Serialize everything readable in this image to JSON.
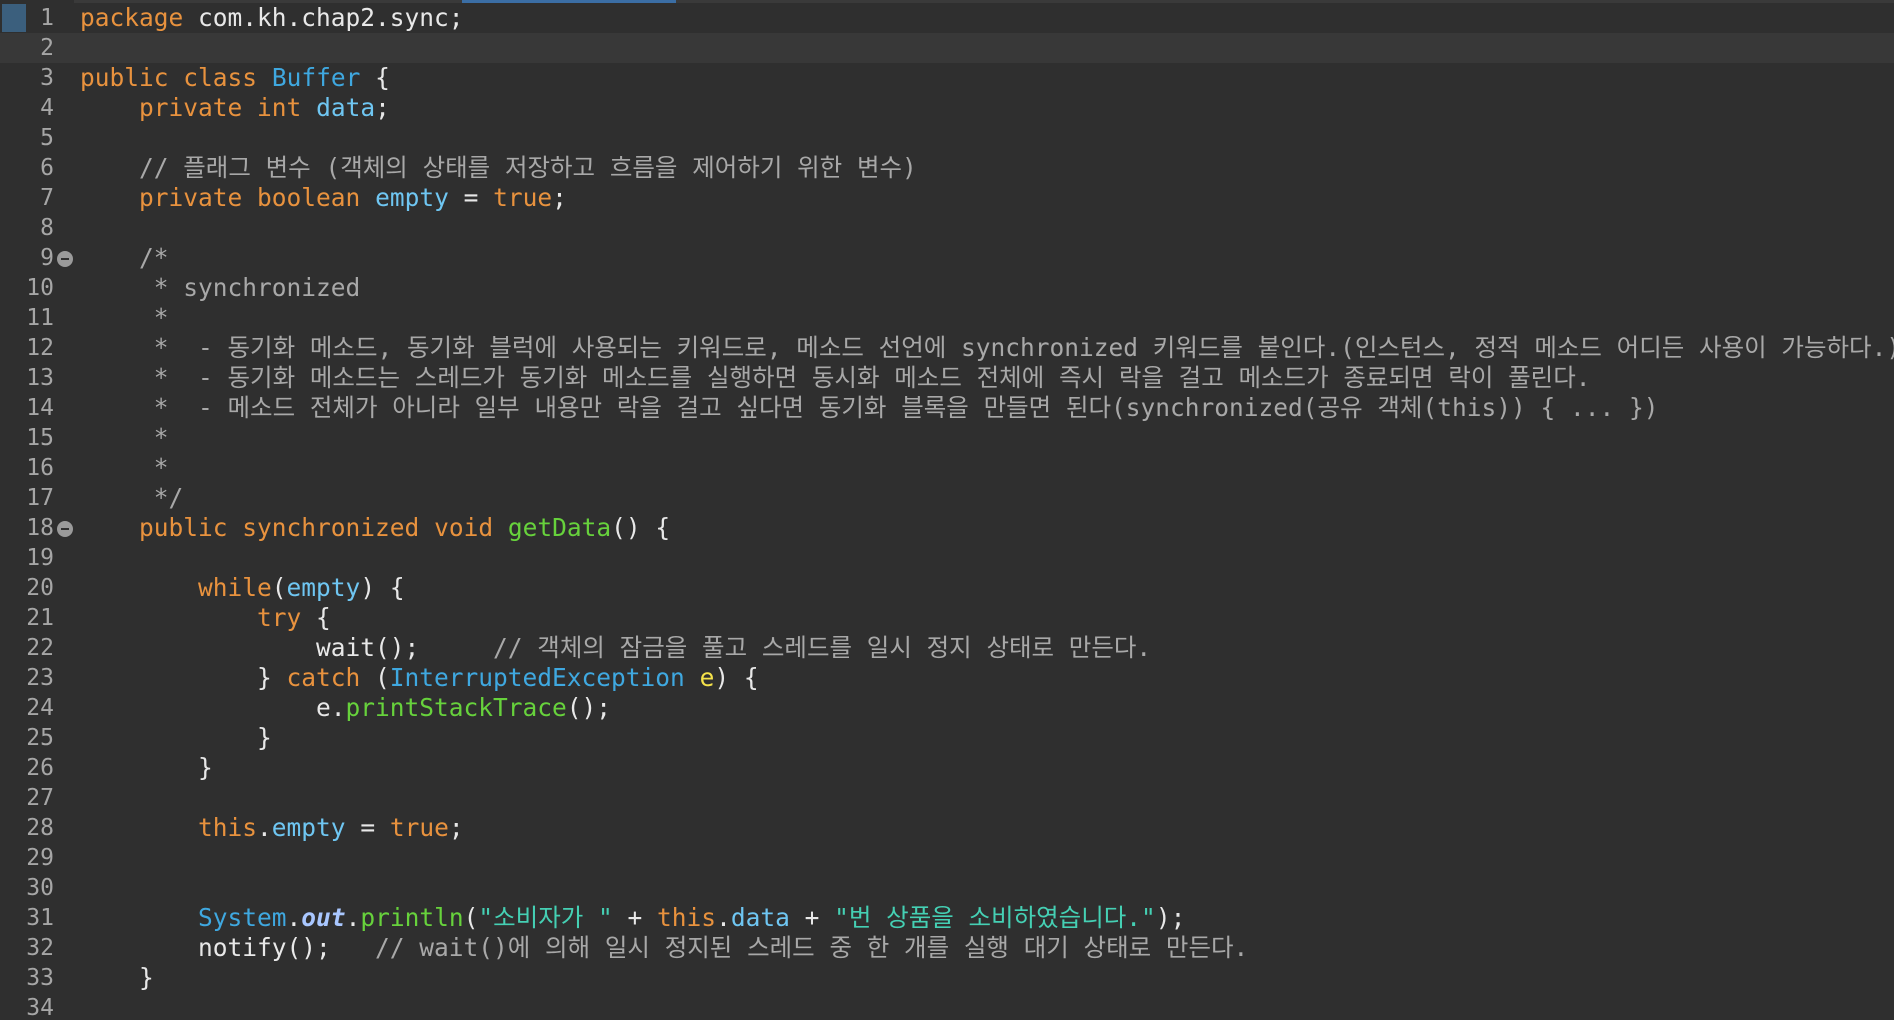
{
  "editor": {
    "lines": [
      {
        "n": "1",
        "tokens": [
          {
            "t": "package",
            "c": "kw"
          },
          {
            "t": " com.kh.chap2.sync;",
            "c": "pl"
          }
        ]
      },
      {
        "n": "2",
        "tokens": []
      },
      {
        "n": "3",
        "tokens": [
          {
            "t": "public",
            "c": "kw"
          },
          {
            "t": " ",
            "c": "pl"
          },
          {
            "t": "class",
            "c": "kw"
          },
          {
            "t": " ",
            "c": "pl"
          },
          {
            "t": "Buffer",
            "c": "ty"
          },
          {
            "t": " {",
            "c": "pl"
          }
        ]
      },
      {
        "n": "4",
        "tokens": [
          {
            "t": "    ",
            "c": "pl"
          },
          {
            "t": "private",
            "c": "kw"
          },
          {
            "t": " ",
            "c": "pl"
          },
          {
            "t": "int",
            "c": "kw"
          },
          {
            "t": " ",
            "c": "pl"
          },
          {
            "t": "data",
            "c": "fld"
          },
          {
            "t": ";",
            "c": "pl"
          }
        ]
      },
      {
        "n": "5",
        "tokens": []
      },
      {
        "n": "6",
        "tokens": [
          {
            "t": "    // 플래그 변수 (객체의 상태를 저장하고 흐름을 제어하기 위한 변수)",
            "c": "cm"
          }
        ]
      },
      {
        "n": "7",
        "tokens": [
          {
            "t": "    ",
            "c": "pl"
          },
          {
            "t": "private",
            "c": "kw"
          },
          {
            "t": " ",
            "c": "pl"
          },
          {
            "t": "boolean",
            "c": "kw"
          },
          {
            "t": " ",
            "c": "pl"
          },
          {
            "t": "empty",
            "c": "fld"
          },
          {
            "t": " = ",
            "c": "pl"
          },
          {
            "t": "true",
            "c": "kw"
          },
          {
            "t": ";",
            "c": "pl"
          }
        ]
      },
      {
        "n": "8",
        "tokens": []
      },
      {
        "n": "9",
        "fold": true,
        "tokens": [
          {
            "t": "    /*",
            "c": "cm"
          }
        ]
      },
      {
        "n": "10",
        "tokens": [
          {
            "t": "     * synchronized",
            "c": "cm"
          }
        ]
      },
      {
        "n": "11",
        "tokens": [
          {
            "t": "     *",
            "c": "cm"
          }
        ]
      },
      {
        "n": "12",
        "tokens": [
          {
            "t": "     *  - 동기화 메소드, 동기화 블럭에 사용되는 키워드로, 메소드 선언에 synchronized 키워드를 붙인다.(인스턴스, 정적 메소드 어디든 사용이 가능하다.)",
            "c": "cm"
          }
        ]
      },
      {
        "n": "13",
        "tokens": [
          {
            "t": "     *  - 동기화 메소드는 스레드가 동기화 메소드를 실행하면 동시화 메소드 전체에 즉시 락을 걸고 메소드가 종료되면 락이 풀린다.",
            "c": "cm"
          }
        ]
      },
      {
        "n": "14",
        "tokens": [
          {
            "t": "     *  - 메소드 전체가 아니라 일부 내용만 락을 걸고 싶다면 동기화 블록을 만들면 된다(synchronized(공유 객체(this)) { ... })",
            "c": "cm"
          }
        ]
      },
      {
        "n": "15",
        "tokens": [
          {
            "t": "     *",
            "c": "cm"
          }
        ]
      },
      {
        "n": "16",
        "tokens": [
          {
            "t": "     *",
            "c": "cm"
          }
        ]
      },
      {
        "n": "17",
        "tokens": [
          {
            "t": "     */",
            "c": "cm"
          }
        ]
      },
      {
        "n": "18",
        "fold": true,
        "tokens": [
          {
            "t": "    ",
            "c": "pl"
          },
          {
            "t": "public",
            "c": "kw"
          },
          {
            "t": " ",
            "c": "pl"
          },
          {
            "t": "synchronized",
            "c": "kw"
          },
          {
            "t": " ",
            "c": "pl"
          },
          {
            "t": "void",
            "c": "kw"
          },
          {
            "t": " ",
            "c": "pl"
          },
          {
            "t": "getData",
            "c": "mth"
          },
          {
            "t": "() {",
            "c": "pl"
          }
        ]
      },
      {
        "n": "19",
        "tokens": []
      },
      {
        "n": "20",
        "tokens": [
          {
            "t": "        ",
            "c": "pl"
          },
          {
            "t": "while",
            "c": "kw"
          },
          {
            "t": "(",
            "c": "pl"
          },
          {
            "t": "empty",
            "c": "fld"
          },
          {
            "t": ") {",
            "c": "pl"
          }
        ]
      },
      {
        "n": "21",
        "tokens": [
          {
            "t": "            ",
            "c": "pl"
          },
          {
            "t": "try",
            "c": "kw"
          },
          {
            "t": " {",
            "c": "pl"
          }
        ]
      },
      {
        "n": "22",
        "tokens": [
          {
            "t": "                ",
            "c": "pl"
          },
          {
            "t": "wait",
            "c": "pl"
          },
          {
            "t": "();     ",
            "c": "pl"
          },
          {
            "t": "// 객체의 잠금을 풀고 스레드를 일시 정지 상태로 만든다.",
            "c": "cm"
          }
        ]
      },
      {
        "n": "23",
        "tokens": [
          {
            "t": "            } ",
            "c": "pl"
          },
          {
            "t": "catch",
            "c": "kw"
          },
          {
            "t": " (",
            "c": "pl"
          },
          {
            "t": "InterruptedException",
            "c": "ty"
          },
          {
            "t": " ",
            "c": "pl"
          },
          {
            "t": "e",
            "c": "loc"
          },
          {
            "t": ") {",
            "c": "pl"
          }
        ]
      },
      {
        "n": "24",
        "tokens": [
          {
            "t": "                e.",
            "c": "pl"
          },
          {
            "t": "printStackTrace",
            "c": "mth"
          },
          {
            "t": "();",
            "c": "pl"
          }
        ]
      },
      {
        "n": "25",
        "tokens": [
          {
            "t": "            }",
            "c": "pl"
          }
        ]
      },
      {
        "n": "26",
        "tokens": [
          {
            "t": "        }",
            "c": "pl"
          }
        ]
      },
      {
        "n": "27",
        "tokens": []
      },
      {
        "n": "28",
        "tokens": [
          {
            "t": "        ",
            "c": "pl"
          },
          {
            "t": "this",
            "c": "kw"
          },
          {
            "t": ".",
            "c": "pl"
          },
          {
            "t": "empty",
            "c": "fld"
          },
          {
            "t": " = ",
            "c": "pl"
          },
          {
            "t": "true",
            "c": "kw"
          },
          {
            "t": ";",
            "c": "pl"
          }
        ]
      },
      {
        "n": "29",
        "tokens": []
      },
      {
        "n": "30",
        "tokens": []
      },
      {
        "n": "31",
        "tokens": [
          {
            "t": "        ",
            "c": "pl"
          },
          {
            "t": "System",
            "c": "ty"
          },
          {
            "t": ".",
            "c": "pl"
          },
          {
            "t": "out",
            "c": "sfld"
          },
          {
            "t": ".",
            "c": "pl"
          },
          {
            "t": "println",
            "c": "mth"
          },
          {
            "t": "(",
            "c": "pl"
          },
          {
            "t": "\"소비자가 \"",
            "c": "str"
          },
          {
            "t": " + ",
            "c": "pl"
          },
          {
            "t": "this",
            "c": "kw"
          },
          {
            "t": ".",
            "c": "pl"
          },
          {
            "t": "data",
            "c": "fld"
          },
          {
            "t": " + ",
            "c": "pl"
          },
          {
            "t": "\"번 상품을 소비하였습니다.\"",
            "c": "str"
          },
          {
            "t": ");",
            "c": "pl"
          }
        ]
      },
      {
        "n": "32",
        "tokens": [
          {
            "t": "        notify();   ",
            "c": "pl"
          },
          {
            "t": "// wait()에 의해 일시 정지된 스레드 중 한 개를 실행 대기 상태로 만든다.",
            "c": "cm"
          }
        ]
      },
      {
        "n": "33",
        "tokens": [
          {
            "t": "    }",
            "c": "pl"
          }
        ]
      },
      {
        "n": "34",
        "tokens": []
      }
    ],
    "current_line": "2"
  }
}
